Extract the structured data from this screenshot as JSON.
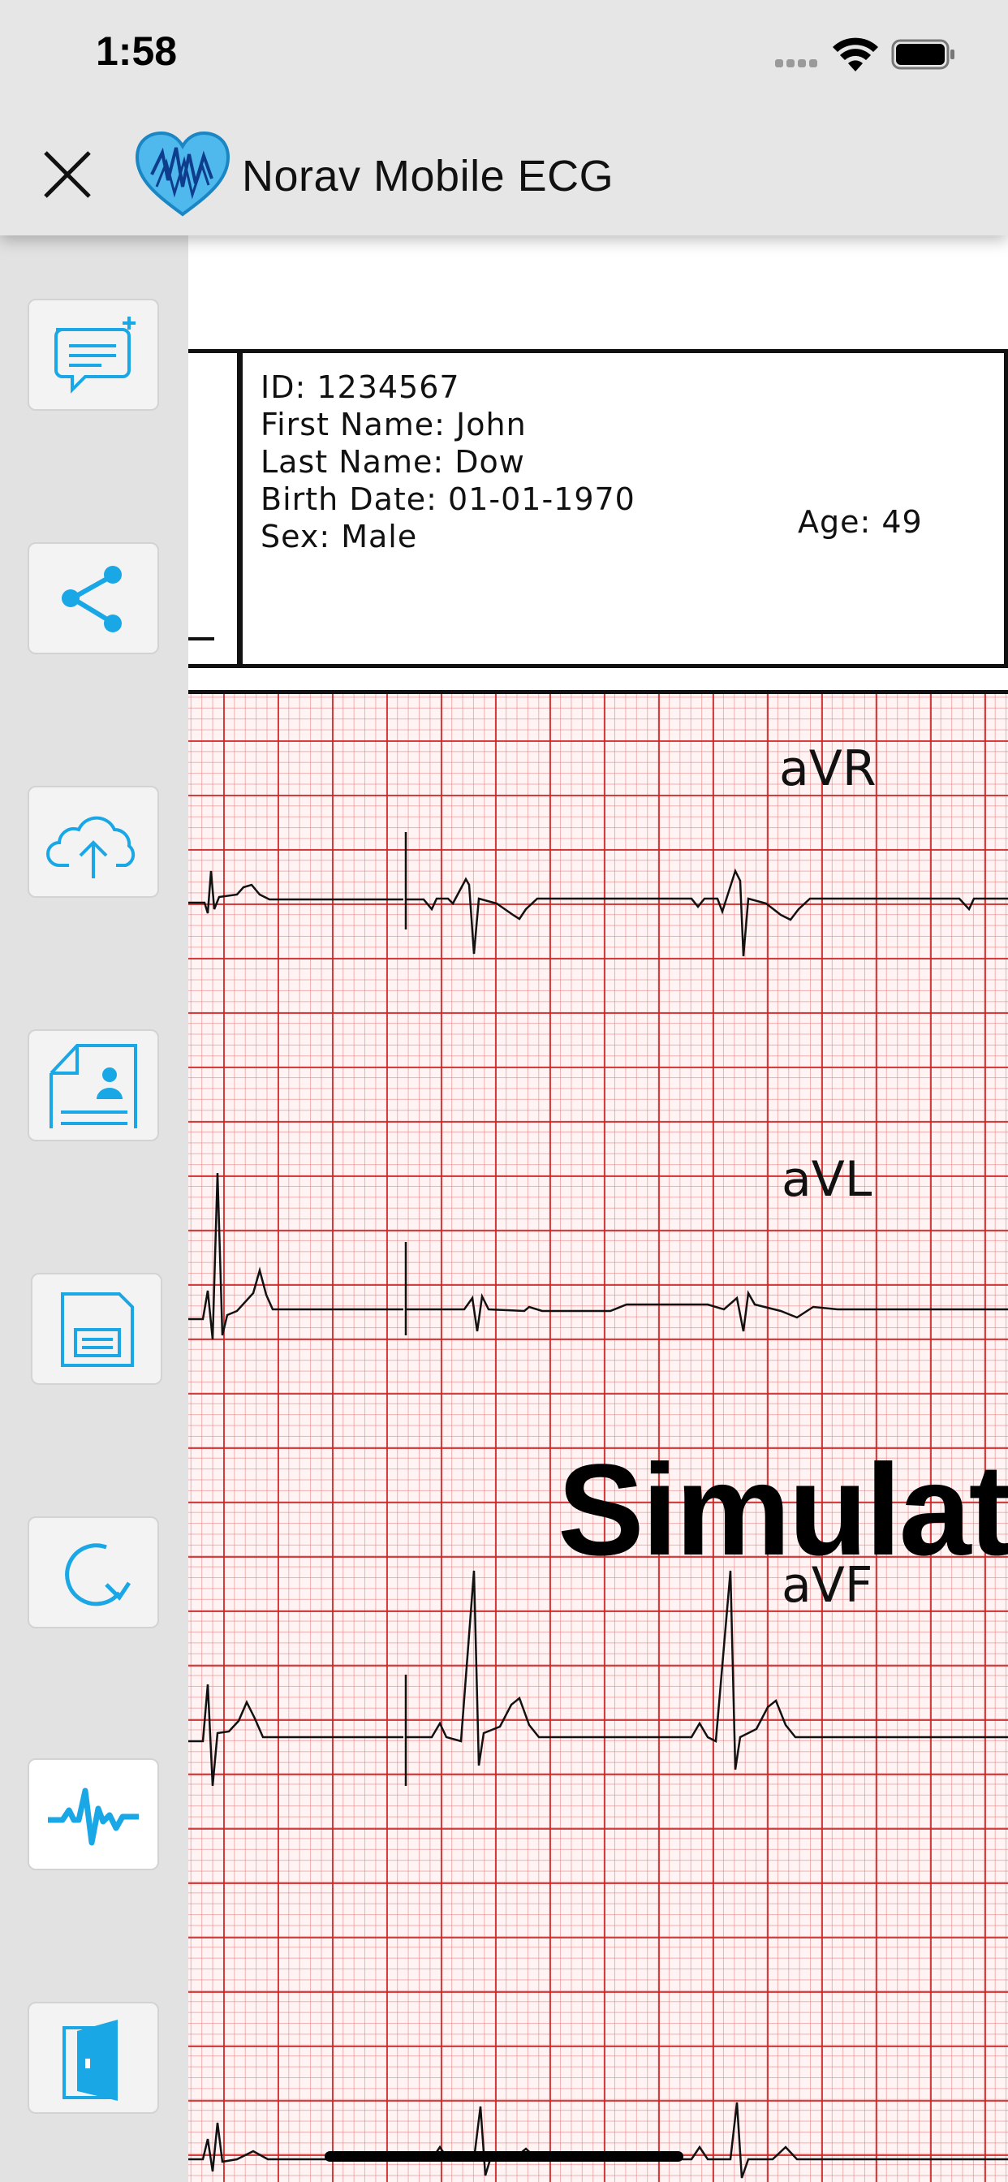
{
  "status_bar": {
    "time": "1:58"
  },
  "header": {
    "title": "Norav Mobile ECG"
  },
  "sidebar": {
    "items": [
      {
        "icon": "add-comment-icon"
      },
      {
        "icon": "share-icon"
      },
      {
        "icon": "cloud-upload-icon"
      },
      {
        "icon": "doctor-report-icon"
      },
      {
        "icon": "save-icon"
      },
      {
        "icon": "refresh-icon"
      },
      {
        "icon": "ecg-waveform-icon"
      },
      {
        "icon": "exit-door-icon"
      }
    ]
  },
  "patient": {
    "id_line": "ID: 1234567",
    "first_name_line": "First Name: John",
    "last_name_line": "Last Name: Dow",
    "birth_date_line": "Birth Date: 01-01-1970",
    "sex_line": "Sex: Male",
    "age_line": "Age: 49"
  },
  "ecg": {
    "leads": [
      "aVR",
      "aVL",
      "aVF"
    ],
    "watermark": "Simulat"
  },
  "colors": {
    "accent": "#1aa7e6",
    "grid_major": "#cd2323",
    "grid_minor": "#e67878"
  }
}
